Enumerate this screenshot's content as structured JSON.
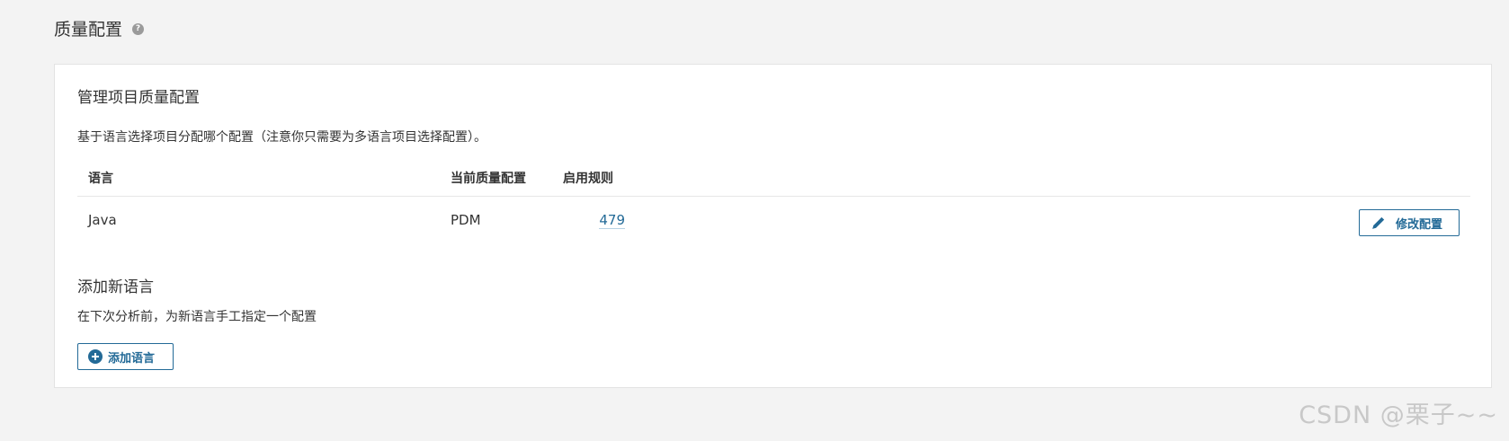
{
  "header": {
    "title": "质量配置",
    "help_icon": "question-circle-icon",
    "help_glyph": "?"
  },
  "panel": {
    "title": "管理项目质量配置",
    "description": "基于语言选择项目分配哪个配置（注意你只需要为多语言项目选择配置）。",
    "table": {
      "columns": [
        "语言",
        "当前质量配置",
        "启用规则"
      ],
      "rows": [
        {
          "language": "Java",
          "profile": "PDM",
          "rules": "479",
          "action": "修改配置",
          "action_icon": "pencil-icon"
        }
      ]
    },
    "add_section": {
      "title": "添加新语言",
      "description": "在下次分析前，为新语言手工指定一个配置",
      "button": "添加语言",
      "button_icon": "plus-circle-icon"
    }
  },
  "watermark": "CSDN @栗子~~",
  "colors": {
    "background": "#f3f3f3",
    "panel": "#ffffff",
    "accent": "#236a97",
    "text": "#333333"
  }
}
